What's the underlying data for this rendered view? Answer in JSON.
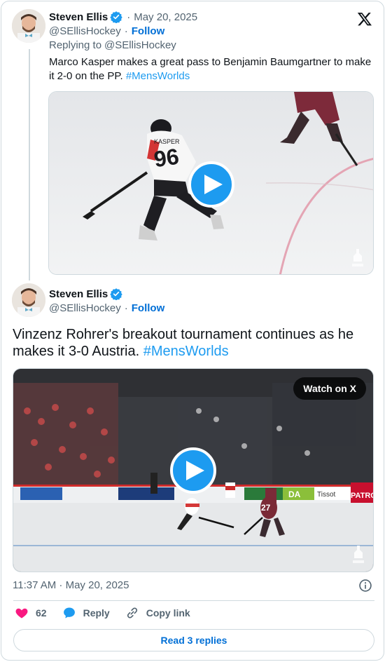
{
  "reply_tweet": {
    "author_name": "Steven Ellis",
    "date": "May 20, 2025",
    "handle": "@SEllisHockey",
    "follow_label": "Follow",
    "replying_to_prefix": "Replying to",
    "replying_to_handle": "@SEllisHockey",
    "text": "Marco Kasper makes a great pass to Benjamin Baumgartner to make it 2-0 on the PP.",
    "hashtag": "#MensWorlds",
    "jersey_number": "96",
    "jersey_name": "KASPER"
  },
  "main_tweet": {
    "author_name": "Steven Ellis",
    "handle": "@SEllisHockey",
    "follow_label": "Follow",
    "text": "Vinzenz Rohrer's breakout tournament continues as he makes it 3-0 Austria.",
    "hashtag": "#MensWorlds",
    "watch_label": "Watch on X",
    "timestamp": "11:37 AM · May 20, 2025",
    "board_ads": [
      "DA",
      "Tissot",
      "PATRON",
      "IIHF"
    ],
    "player_number": "27"
  },
  "actions": {
    "likes_count": "62",
    "reply_label": "Reply",
    "copy_link_label": "Copy link",
    "read_replies_label": "Read 3 replies"
  },
  "colors": {
    "accent": "#1d9bf0",
    "follow": "#006fd6",
    "like": "#f91880",
    "muted": "#536471"
  },
  "icons": [
    "x-logo-icon",
    "verified-badge-icon",
    "play-icon",
    "info-icon",
    "heart-icon",
    "reply-icon",
    "link-icon",
    "iihf-logo-icon"
  ]
}
